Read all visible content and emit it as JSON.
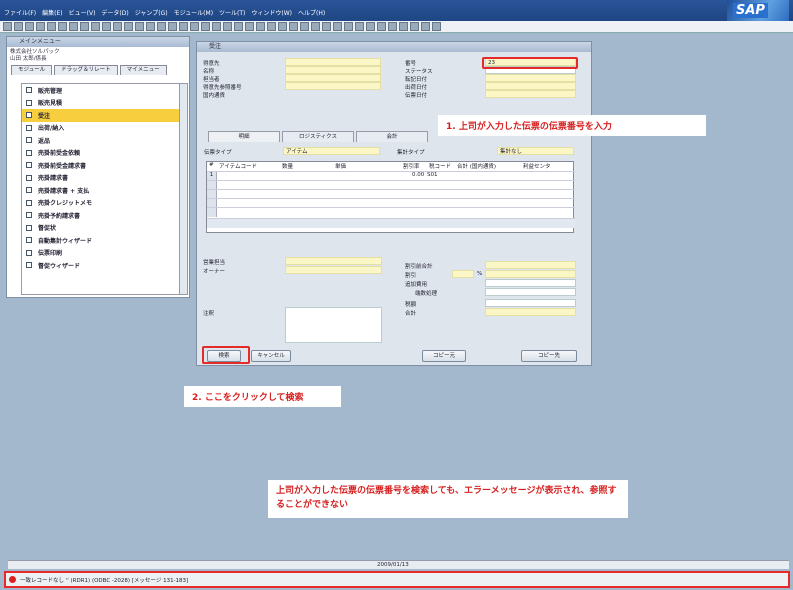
{
  "menubar": [
    "ファイル(F)",
    "編集(E)",
    "ビュー(V)",
    "データ(D)",
    "ジャンプ(G)",
    "モジュール(M)",
    "ツール(T)",
    "ウィンドウ(W)",
    "ヘルプ(H)"
  ],
  "brand": {
    "logo": "SAP"
  },
  "main_menu": {
    "title": "メインメニュー",
    "company": "株式会社ソルパック",
    "user": "山田 太郎/係長",
    "tabs": [
      "モジュール",
      "ドラッグ＆リレート",
      "マイメニュー"
    ],
    "items": [
      "販売管理",
      "販売見積",
      "受注",
      "出荷/納入",
      "返品",
      "売掛前受金依頼",
      "売掛前受金請求書",
      "売掛請求書",
      "売掛請求書 + 支払",
      "売掛クレジットメモ",
      "売掛予約請求書",
      "督促状",
      "自動集計ウィザード",
      "伝票印刷",
      "督促ウィザード"
    ],
    "active_index": 2
  },
  "order_window": {
    "title": "受注",
    "left_labels": [
      "得意先",
      "名称",
      "担当者",
      "得意先参照番号",
      "国内通貨"
    ],
    "right_labels": [
      "番号",
      "ステータス",
      "転記日付",
      "出荷日付",
      "伝票日付"
    ],
    "doc_number": "23",
    "tabs": [
      "明細",
      "ロジスティクス",
      "会計"
    ],
    "item_type_label": "伝票タイプ",
    "item_type_value": "アイテム",
    "summary_type_label": "集計タイプ",
    "summary_type_value": "集計なし",
    "grid_headers": [
      "#",
      "アイテムコード",
      "数量",
      "単価",
      "割引率",
      "税コード",
      "合計 (国内通貨)",
      "利益センタ"
    ],
    "grid_row1": {
      "num": "1",
      "discount": "0.00",
      "tax": "S01"
    },
    "sales_rep_label": "営業担当",
    "owner_label": "オーナー",
    "remarks_label": "注釈",
    "totals_labels": [
      "割引前合計",
      "割引",
      "追加費用",
      "端数処理",
      "税額",
      "合計"
    ],
    "percent": "%",
    "rounding_label": "端数処理",
    "buttons": {
      "search": "検索",
      "cancel": "キャンセル",
      "copy_from": "コピー元",
      "copy_to": "コピー先"
    }
  },
  "callouts": {
    "step1": "1. 上司が入力した伝票の伝票番号を入力",
    "step2": "2. ここをクリックして検索",
    "note": "上司が入力した伝票の伝票番号を検索しても、エラーメッセージが表示され、参照することができない"
  },
  "status": {
    "date": "2009/01/13",
    "message": "一致レコードなし '' (RDR1) (ODBC -2028) [メッセージ 131-183]"
  },
  "colors": {
    "highlight": "#f7ce3e",
    "error": "#e52a2a",
    "field": "#fbf6c5"
  }
}
